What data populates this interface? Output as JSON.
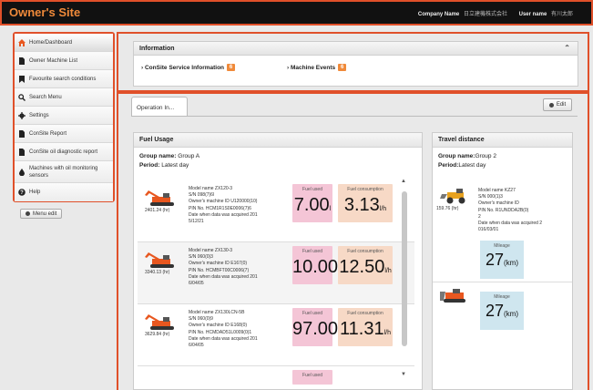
{
  "header": {
    "title": "Owner's Site",
    "company_label": "Company Name",
    "company_value": "日立建機株式会社",
    "user_label": "User name",
    "user_value": "有川太郎"
  },
  "sidebar": {
    "items": [
      {
        "label": "Home/Dashboard",
        "icon": "home-icon"
      },
      {
        "label": "Owner Machine List",
        "icon": "document-icon"
      },
      {
        "label": "Favourite search conditions",
        "icon": "bookmark-icon"
      },
      {
        "label": "Search Menu",
        "icon": "search-icon"
      },
      {
        "label": "Settings",
        "icon": "gear-icon"
      },
      {
        "label": "ConSite Report",
        "icon": "document-icon"
      },
      {
        "label": "ConSite oil diagnostic report",
        "icon": "document-icon"
      },
      {
        "label": "Machines with oil monitoring sensors",
        "icon": "oil-drop-icon"
      },
      {
        "label": "Help",
        "icon": "help-icon"
      }
    ],
    "menu_edit_label": "Menu edit"
  },
  "information": {
    "title": "Information",
    "links": [
      {
        "label": "ConSite Service Information",
        "badge": "6"
      },
      {
        "label": "Machine Events",
        "badge": "6"
      }
    ]
  },
  "main": {
    "tab_label": "Operation In...",
    "edit_label": "Edit"
  },
  "fuel_usage": {
    "title": "Fuel Usage",
    "group_label": "Group name:",
    "group_value": "Group A",
    "period_label": "Period:",
    "period_value": "Latest day",
    "used_label": "Fuel used",
    "consumption_label": "Fuel consumption",
    "machines": [
      {
        "hours": "2401.24 (hr)",
        "model": "Model name ZX120-3",
        "sn": "S/N 098(7)6l",
        "owner_id": "Owner's machine ID U120000(10)",
        "pin": "PIN No. HCM1R1S0E0006(7)6",
        "date_label": "Date when data was acquired 201",
        "date_value": "5/12/21",
        "fuel_used": "7.00",
        "fuel_used_unit": "l",
        "fuel_consumption": "3.13",
        "fuel_consumption_unit": "l/h"
      },
      {
        "hours": "3340.13 (hr)",
        "model": "Model name ZX130-3",
        "sn": "S/N 060(0)3",
        "owner_id": "Owner's machine ID E167(0)",
        "pin": "PIN No. HCMBFT00C0006(7)",
        "date_label": "Date when data was acquired 201",
        "date_value": "6/04/05",
        "fuel_used": "10.00",
        "fuel_used_unit": "l",
        "fuel_consumption": "12.50",
        "fuel_consumption_unit": "l/h"
      },
      {
        "hours": "3629.84 (hr)",
        "model": "Model name ZX130LCN-5B",
        "sn": "S/N 060(0)9",
        "owner_id": "Owner's machine ID E168(0)",
        "pin": "PIN No. HCMDAD51L0009(0)1",
        "date_label": "Date when data was acquired 201",
        "date_value": "6/04/05",
        "fuel_used": "97.00",
        "fuel_used_unit": "l",
        "fuel_consumption": "11.31",
        "fuel_consumption_unit": "l/h"
      }
    ]
  },
  "travel_distance": {
    "title": "Travel distance",
    "group_label": "Group name:",
    "group_value": "Group 2",
    "period_label": "Period:",
    "period_value": "Latest day",
    "mileage_label": "Mileage",
    "machines": [
      {
        "hours": "159.76 (hr)",
        "model": "Model name KZ27",
        "sn": "S/N 000(1)3",
        "owner_id": "Owner's machine ID",
        "pin": "PIN No. R1UNDDA2B(0)",
        "pin_cont": "2",
        "date_label": "Date when data was acquired 2",
        "date_value": "016/03/01",
        "mileage": "27",
        "mileage_unit": "(km)"
      },
      {
        "mileage": "27",
        "mileage_unit": "(km)"
      }
    ]
  },
  "colors": {
    "accent": "#e0502a",
    "title_orange": "#f08a3a",
    "fuel_used_bg": "#f4c5d6",
    "fuel_consumption_bg": "#f7d9c6",
    "mileage_bg": "#cfe6ef",
    "machine_orange": "#e8571f"
  }
}
